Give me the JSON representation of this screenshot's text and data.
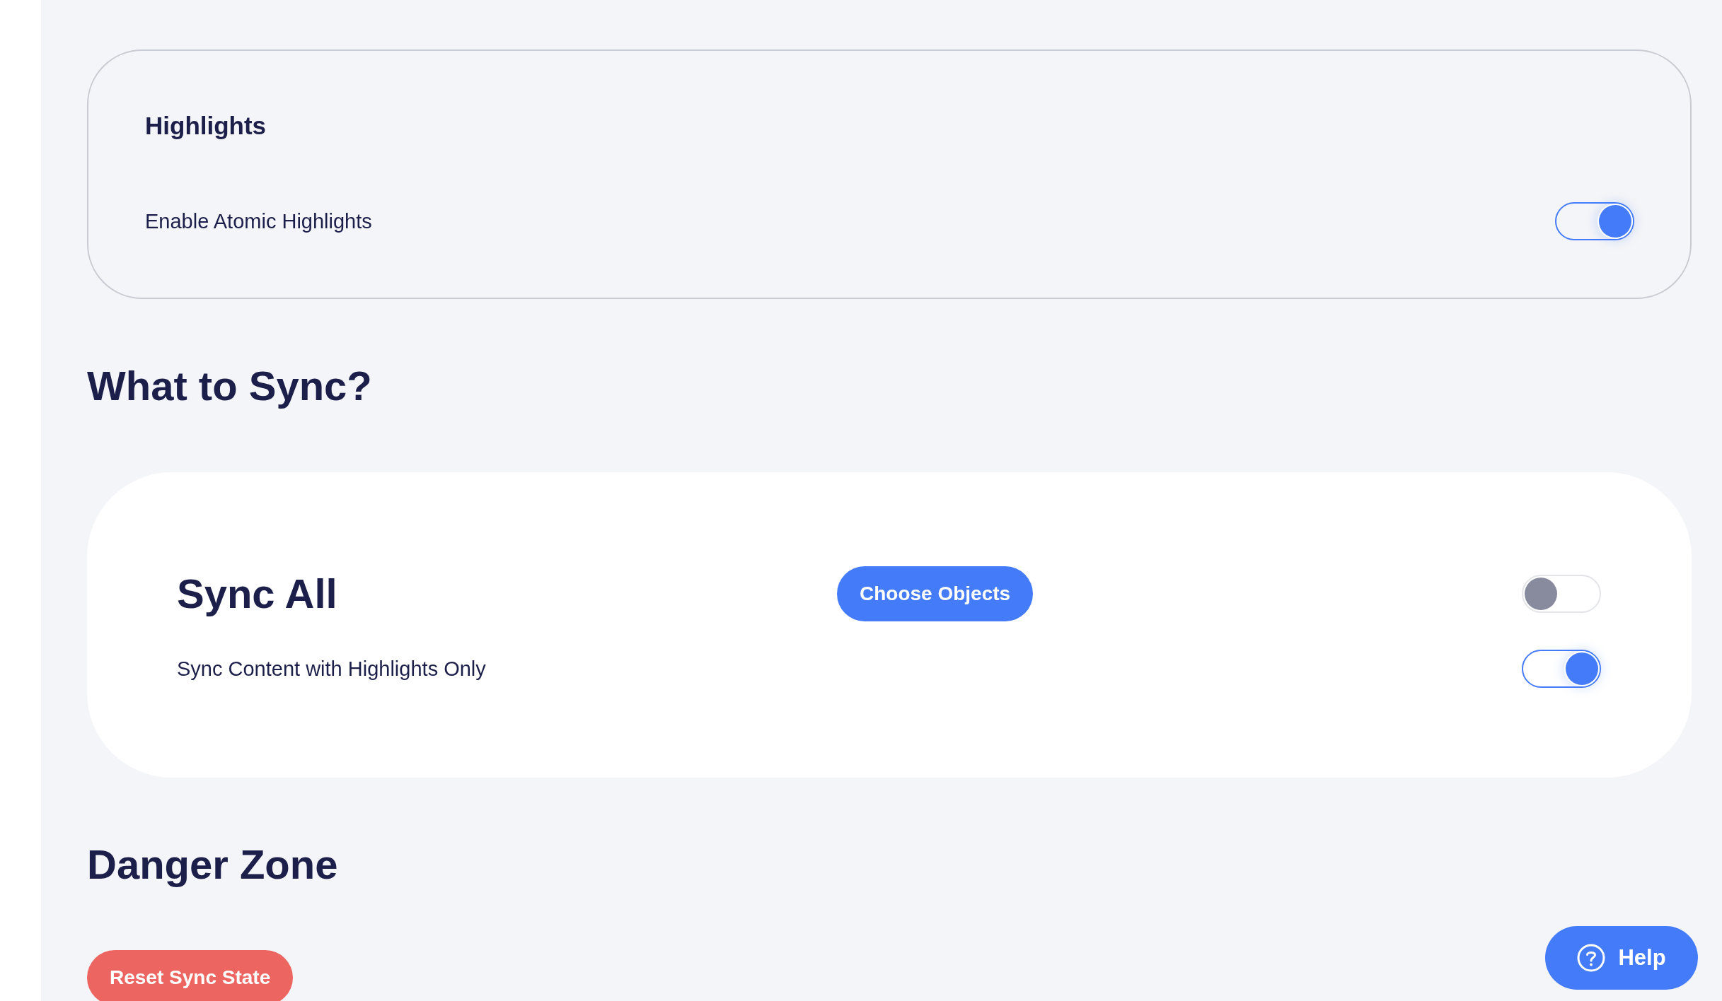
{
  "highlights_card": {
    "title": "Highlights",
    "toggles": [
      {
        "label": "Enable Atomic Highlights",
        "on": true
      }
    ]
  },
  "sync_section": {
    "heading": "What to Sync?",
    "title": "Sync All",
    "button": "Choose Objects",
    "title_toggle": {
      "on": false
    },
    "toggles": [
      {
        "label": "Sync Content with Highlights Only",
        "on": true
      }
    ]
  },
  "danger_section": {
    "heading": "Danger Zone",
    "button": "Reset Sync State"
  },
  "help_button": {
    "label": "Help"
  }
}
